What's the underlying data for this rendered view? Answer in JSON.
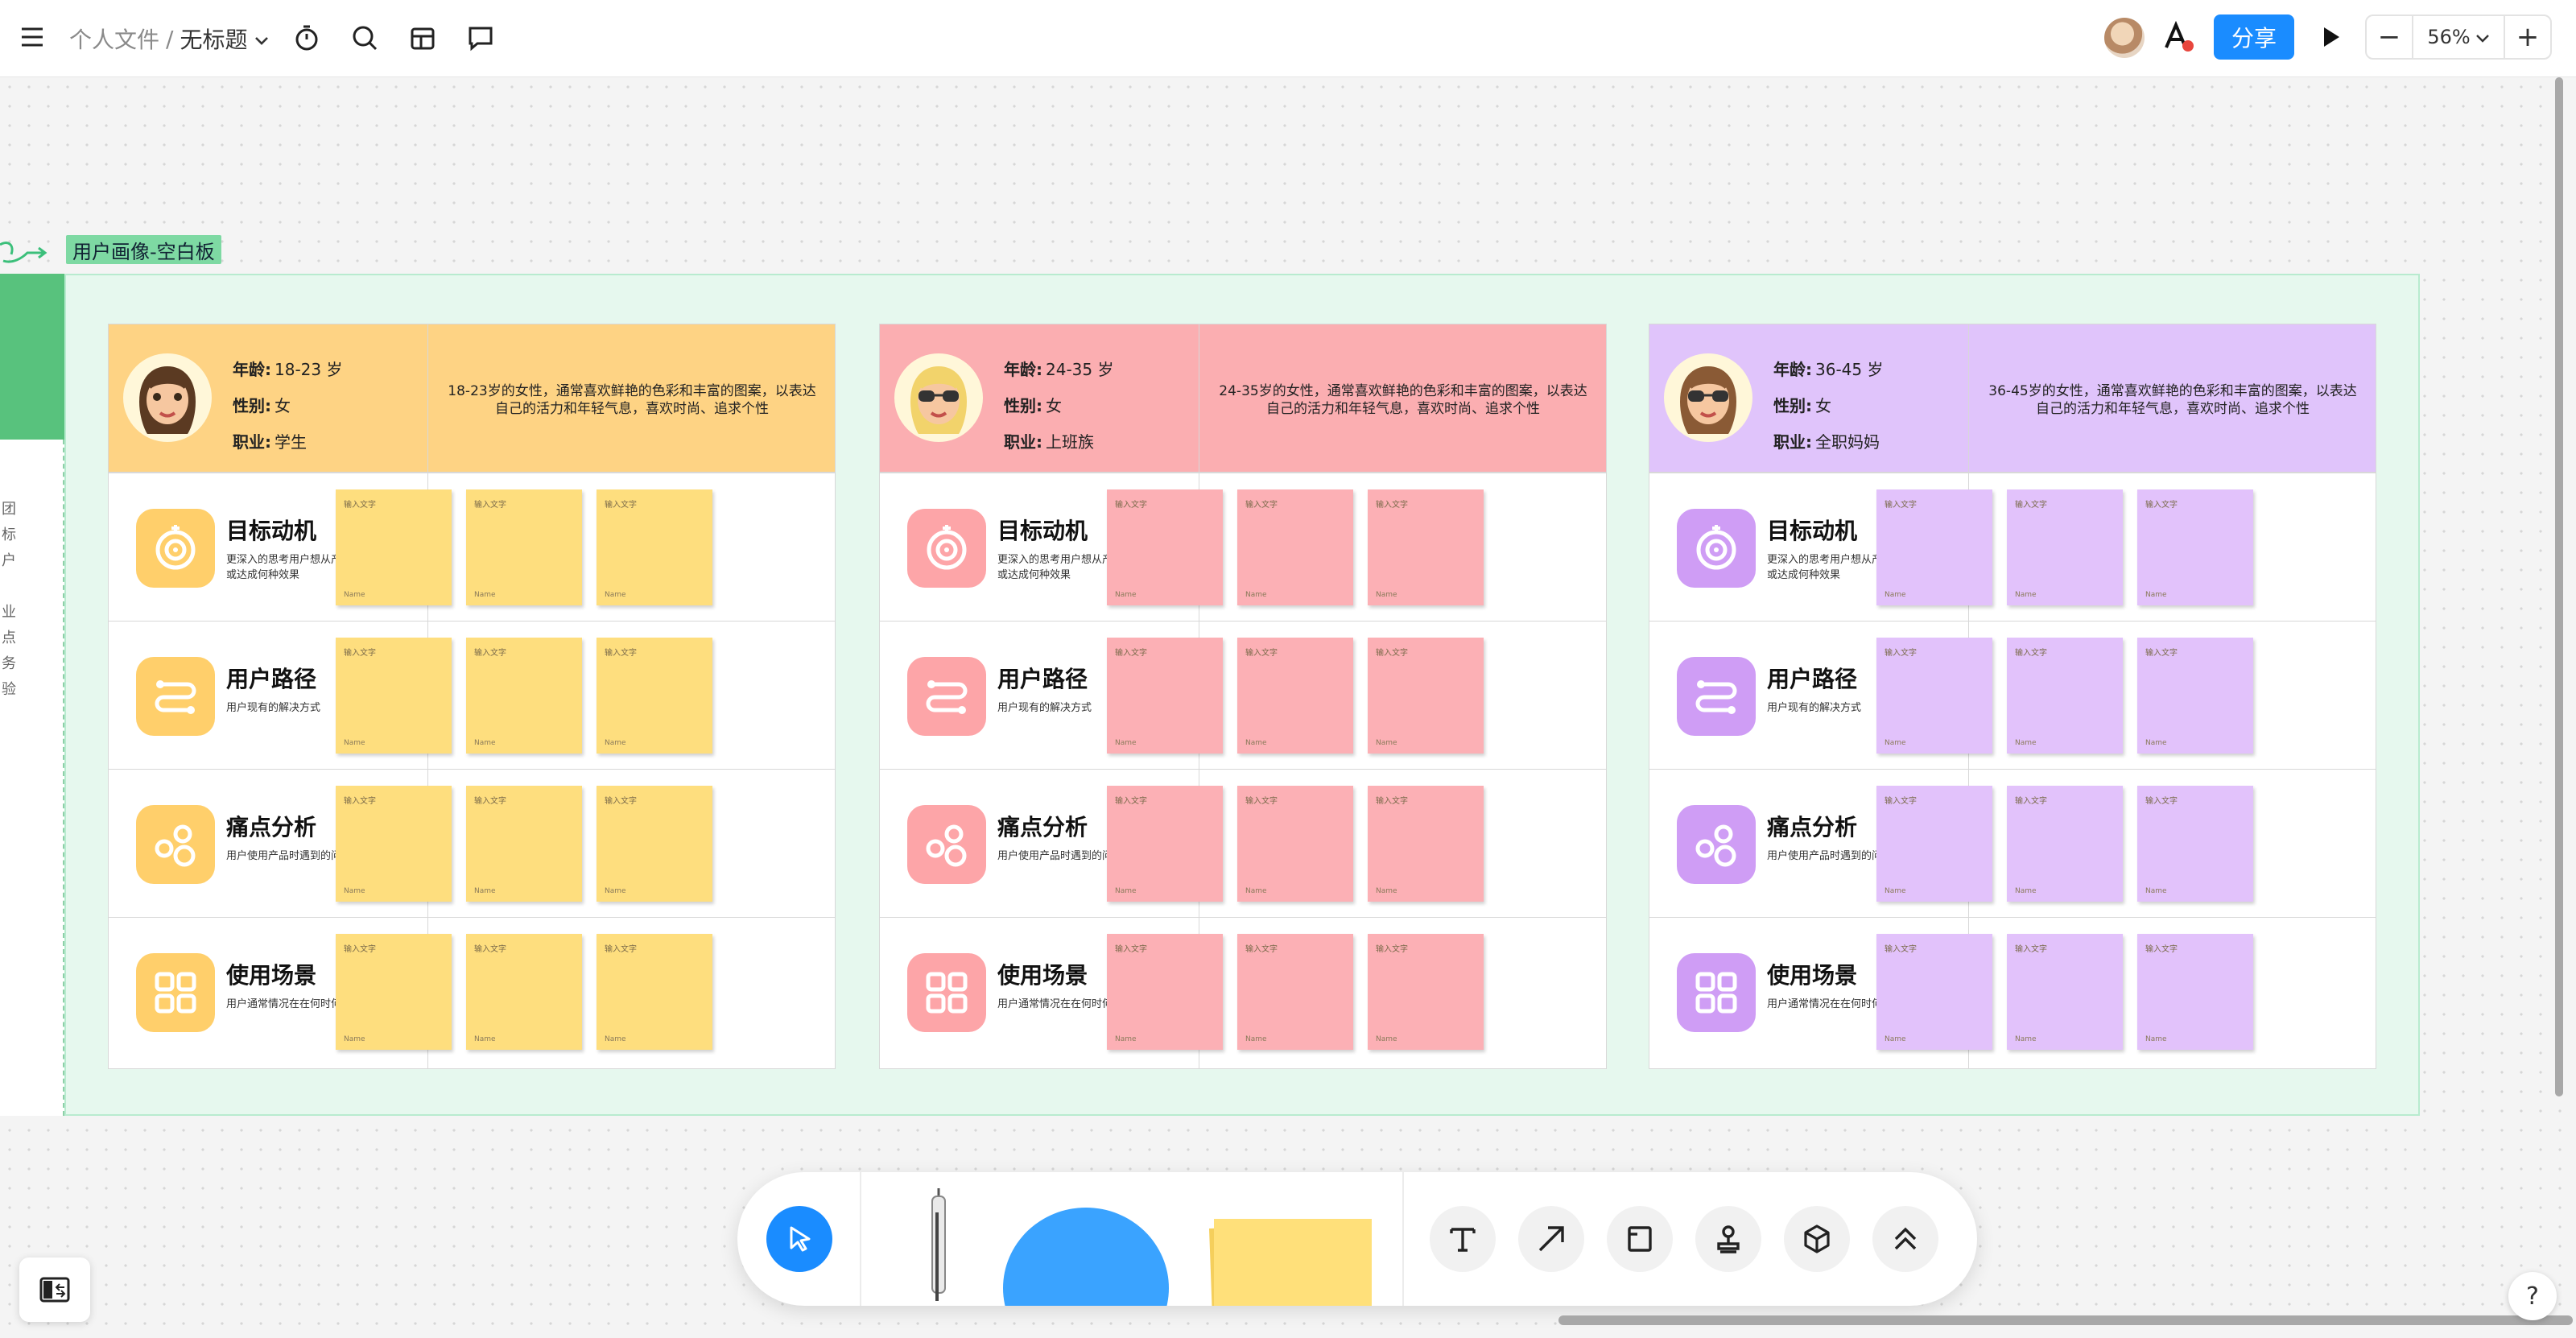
{
  "topbar": {
    "breadcrumb_root": "个人文件",
    "breadcrumb_sep": "/",
    "doc_title": "无标题",
    "share_label": "分享",
    "zoom_value": "56%",
    "zoom_out": "−",
    "zoom_in": "+"
  },
  "frame": {
    "label": "用户画像-空白板",
    "left_chars": [
      "团",
      "标",
      "户",
      "",
      "业",
      "点",
      "务",
      "验"
    ]
  },
  "sticky": {
    "placeholder": "输入文字",
    "author": "Name"
  },
  "rows": [
    {
      "title": "目标动机",
      "sub": "更深入的思考用户想从产品中获得什么，或达成何种效果",
      "icon": "target-icon"
    },
    {
      "title": "用户路径",
      "sub": "用户现有的解决方式",
      "icon": "path-icon"
    },
    {
      "title": "痛点分析",
      "sub": "用户使用产品时遇到的问题",
      "icon": "bubbles-icon"
    },
    {
      "title": "使用场景",
      "sub": "用户通常情况在在何时何地使用的产品",
      "icon": "grid-icon"
    }
  ],
  "personas": [
    {
      "age_label": "年龄:",
      "age": "18-23 岁",
      "gender_label": "性别:",
      "gender": "女",
      "job_label": "职业:",
      "job": "学生",
      "desc": "18-23岁的女性，通常喜欢鲜艳的色彩和丰富的图案，以表达自己的活力和年轻气息，喜欢时尚、追求个性",
      "head_color": "#fed384",
      "icon_color": "#ffcf6b",
      "note_color": "#fede7e"
    },
    {
      "age_label": "年龄:",
      "age": "24-35 岁",
      "gender_label": "性别:",
      "gender": "女",
      "job_label": "职业:",
      "job": "上班族",
      "desc": "24-35岁的女性，通常喜欢鲜艳的色彩和丰富的图案，以表达自己的活力和年轻气息，喜欢时尚、追求个性",
      "head_color": "#fbaeb1",
      "icon_color": "#fda5a8",
      "note_color": "#fcb0b5"
    },
    {
      "age_label": "年龄:",
      "age": "36-45 岁",
      "gender_label": "性别:",
      "gender": "女",
      "job_label": "职业:",
      "job": "全职妈妈",
      "desc": "36-45岁的女性，通常喜欢鲜艳的色彩和丰富的图案，以表达自己的活力和年轻气息，喜欢时尚、追求个性",
      "head_color": "#e0c4fb",
      "icon_color": "#cf9df5",
      "note_color": "#e2c2fb"
    }
  ],
  "dock": {
    "accent": "#1a8cff",
    "sticky_color": "#ffe07a",
    "shape_color": "#3aa3ff"
  }
}
